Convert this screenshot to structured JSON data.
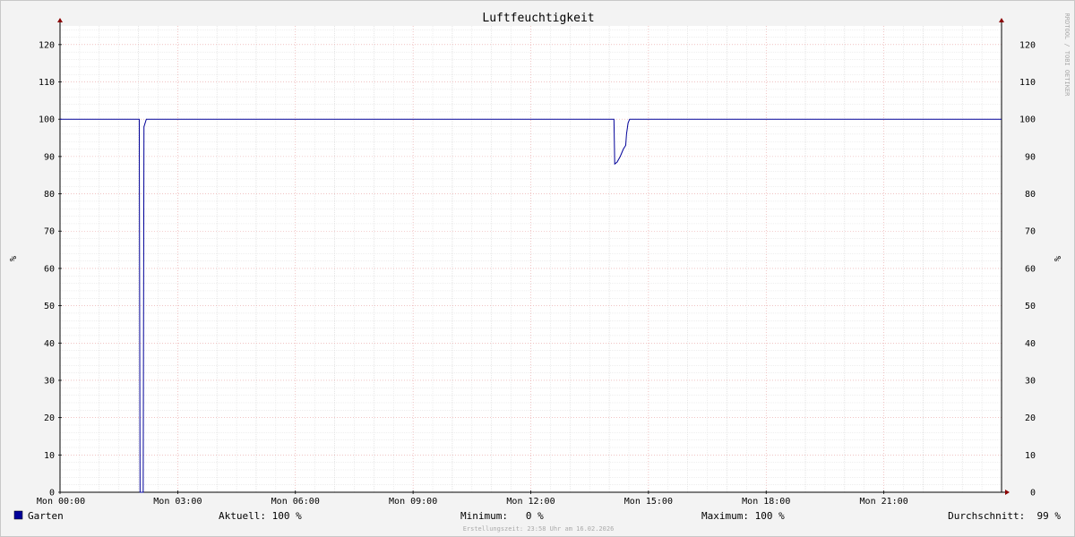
{
  "chart_data": {
    "type": "line",
    "title": "Luftfeuchtigkeit",
    "ylabel": "%",
    "ylabel_right": "%",
    "ylim": [
      0,
      125
    ],
    "yticks": [
      0,
      10,
      20,
      30,
      40,
      50,
      60,
      70,
      80,
      90,
      100,
      110,
      120
    ],
    "xlim_hours": [
      0,
      24
    ],
    "xticks": [
      {
        "hour": 0,
        "label": "Mon 00:00"
      },
      {
        "hour": 3,
        "label": "Mon 03:00"
      },
      {
        "hour": 6,
        "label": "Mon 06:00"
      },
      {
        "hour": 9,
        "label": "Mon 09:00"
      },
      {
        "hour": 12,
        "label": "Mon 12:00"
      },
      {
        "hour": 15,
        "label": "Mon 15:00"
      },
      {
        "hour": 18,
        "label": "Mon 18:00"
      },
      {
        "hour": 21,
        "label": "Mon 21:00"
      }
    ],
    "grid": true,
    "series": [
      {
        "name": "Garten",
        "color": "#000099",
        "points": [
          [
            0,
            100
          ],
          [
            2.02,
            100
          ],
          [
            2.04,
            0
          ],
          [
            2.12,
            0
          ],
          [
            2.14,
            98
          ],
          [
            2.2,
            100
          ],
          [
            14.12,
            100
          ],
          [
            14.14,
            88
          ],
          [
            14.2,
            88.5
          ],
          [
            14.28,
            90
          ],
          [
            14.36,
            92
          ],
          [
            14.42,
            93
          ],
          [
            14.44,
            96
          ],
          [
            14.48,
            99
          ],
          [
            14.52,
            100
          ],
          [
            24,
            100
          ]
        ]
      }
    ],
    "legend": {
      "position": "bottom",
      "series_label": "Garten",
      "color": "#000099",
      "aktuell": "Aktuell: 100 %",
      "minimum": "Minimum:   0 %",
      "maximum": "Maximum: 100 %",
      "durchschnitt": "Durchschnitt:  99 %"
    },
    "watermark": "RRDTOOL / TOBI OETIKER",
    "footer": "Erstellungszeit: 23:58 Uhr am 16.02.2026"
  }
}
